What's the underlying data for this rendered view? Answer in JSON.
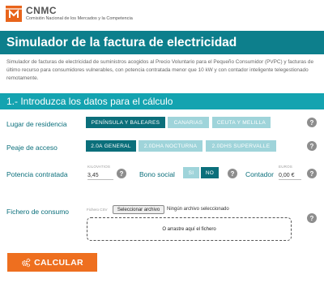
{
  "brand": {
    "name": "CNMC",
    "subtitle": "Comisión Nacional de los Mercados y la Competencia",
    "color": "#e8641b"
  },
  "page": {
    "title": "Simulador de la factura de electricidad",
    "intro": "Simulador de facturas de electricidad de suministros acogidos al Precio Voluntario para el Pequeño Consumidor (PVPC) y facturas de último recurso para consumidores vulnerables, con potencia contratada menor que 10 kW y con contador inteligente telegestionado remotamente."
  },
  "section": {
    "title": "1.- Introduzca los datos para el cálculo"
  },
  "form": {
    "residence": {
      "label": "Lugar de residencia",
      "options": [
        "PENÍNSULA Y BALEARES",
        "CANARIAS",
        "CEUTA Y MELILLA"
      ],
      "selected": "PENÍNSULA Y BALEARES"
    },
    "tariff": {
      "label": "Peaje de acceso",
      "options": [
        "2.0A GENERAL",
        "2.0DHA NOCTURNA",
        "2.0DHS SUPERVALLE"
      ],
      "selected": "2.0A GENERAL"
    },
    "power": {
      "label": "Potencia contratada",
      "unit": "KILOVATIOS",
      "value": "3,45"
    },
    "social": {
      "label": "Bono social",
      "yes": "SI",
      "no": "NO",
      "selected": "NO"
    },
    "meter": {
      "label": "Contador",
      "unit": "EUROS",
      "value": "0,00 €"
    },
    "consumption": {
      "label": "Fichero de consumo",
      "file_caption": "Fichero CSV",
      "choose_button": "Seleccionar archivo",
      "no_file": "Ningún archivo seleccionado",
      "drop_text": "O arrastre aquí el fichero"
    },
    "help_glyph": "?"
  },
  "actions": {
    "calculate": "CALCULAR"
  },
  "colors": {
    "teal_dark": "#0b6f7b",
    "teal_banner": "#0d7f8c",
    "teal_section": "#14a3b0",
    "teal_light": "#9fd4da",
    "orange": "#ee6f1f"
  }
}
